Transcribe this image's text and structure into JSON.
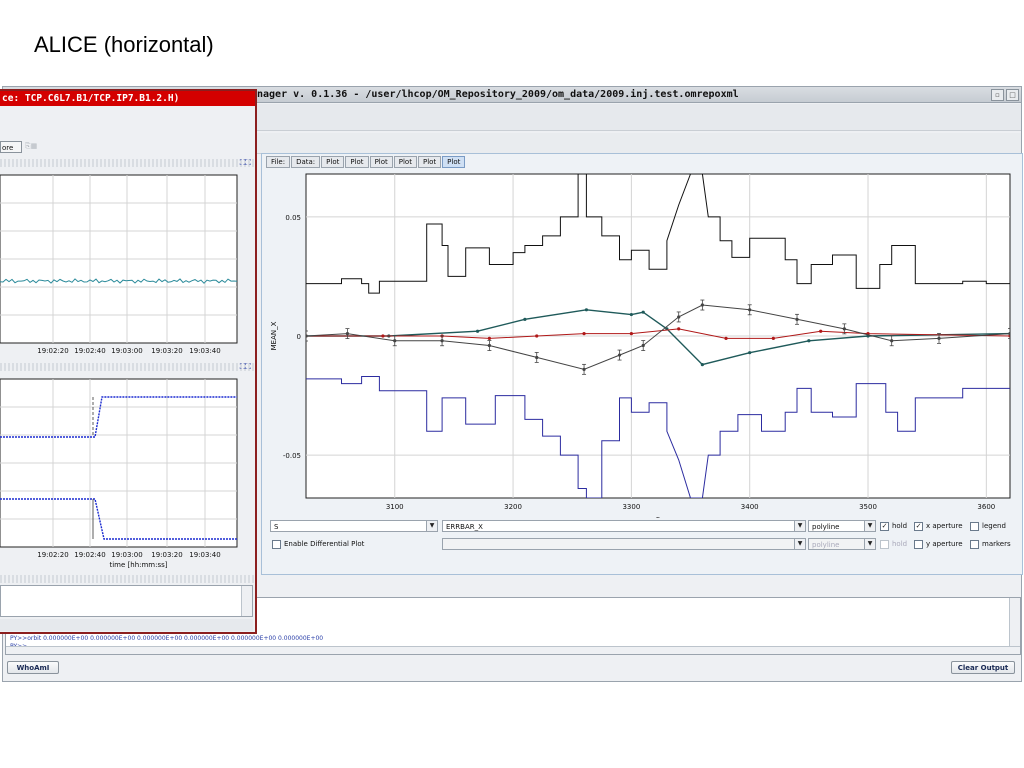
{
  "slide_title": "ALICE (horizontal)",
  "main_window": {
    "title": "nager v. 0.1.36 - /user/lhcop/OM_Repository_2009/om_data/2009.inj.test.omrepoxml"
  },
  "tabs": [
    {
      "label": "File:"
    },
    {
      "label": "Data:"
    },
    {
      "label": "Plot"
    },
    {
      "label": "Plot"
    },
    {
      "label": "Plot"
    },
    {
      "label": "Plot"
    },
    {
      "label": "Plot"
    },
    {
      "label": "Plot"
    }
  ],
  "active_tab_index": 7,
  "controls": {
    "x_variable": "S",
    "y_variable": "ERRBAR_X",
    "plot_style": "polyline",
    "plot_style_disabled": "polyline",
    "hold": {
      "label": "hold",
      "checked": true
    },
    "x_aperture": {
      "label": "x aperture",
      "checked": true
    },
    "legend": {
      "label": "legend",
      "checked": false
    },
    "hold2": {
      "label": "hold",
      "checked": false
    },
    "y_aperture": {
      "label": "y aperture",
      "checked": false
    },
    "markers": {
      "label": "markers",
      "checked": false
    },
    "enable_diff": {
      "label": "Enable Differential Plot",
      "checked": false
    }
  },
  "console": {
    "line1": "PY>>orbit    0.000000E+00  0.000000E+00  0.000000E+00  0.000000E+00  0.000000E+00  0.000000E+00",
    "line2": "PY>>"
  },
  "buttons": {
    "whoami": "WhoAmI",
    "clear_output": "Clear Output"
  },
  "overlay_window": {
    "title": "ce: TCP.C6L7.B1/TCP.IP7.B1.2.H)",
    "more_button": "ore",
    "chart1": {
      "x_ticks": [
        "19:02:20",
        "19:02:40",
        "19:03:00",
        "19:03:20",
        "19:03:40"
      ]
    },
    "chart2": {
      "x_ticks": [
        "19:02:20",
        "19:02:40",
        "19:03:00",
        "19:03:20",
        "19:03:40"
      ],
      "xlabel": "time [hh:mm:ss]"
    }
  },
  "chart_data": {
    "type": "line",
    "xlabel": "S",
    "ylabel": "MEAN_X",
    "xlim": [
      3025,
      3620
    ],
    "ylim": [
      -0.068,
      0.068
    ],
    "x_ticks": [
      3100,
      3200,
      3300,
      3400,
      3500,
      3600
    ],
    "y_ticks": [
      {
        "v": 0.05,
        "label": "0.05"
      },
      {
        "v": 0,
        "label": "0"
      },
      {
        "v": -0.05,
        "label": "-0.05"
      }
    ],
    "grid": true,
    "colors": {
      "aperture_top": "#111111",
      "aperture_bottom": "#2c2ca0",
      "orbit_teal": "#1f5a5a",
      "orbit_red": "#b01818",
      "orbit_grey": "#444444"
    },
    "aperture_top": [
      [
        3025,
        0.022
      ],
      [
        3055,
        0.022
      ],
      [
        3055,
        0.024
      ],
      [
        3072,
        0.024
      ],
      [
        3072,
        0.022
      ],
      [
        3078,
        0.022
      ],
      [
        3078,
        0.018
      ],
      [
        3087,
        0.018
      ],
      [
        3087,
        0.023
      ],
      [
        3127,
        0.023
      ],
      [
        3127,
        0.047
      ],
      [
        3140,
        0.047
      ],
      [
        3140,
        0.038
      ],
      [
        3145,
        0.038
      ],
      [
        3145,
        0.025
      ],
      [
        3160,
        0.025
      ],
      [
        3160,
        0.037
      ],
      [
        3180,
        0.037
      ],
      [
        3180,
        0.03
      ],
      [
        3200,
        0.03
      ],
      [
        3200,
        0.035
      ],
      [
        3210,
        0.035
      ],
      [
        3210,
        0.038
      ],
      [
        3225,
        0.038
      ],
      [
        3225,
        0.042
      ],
      [
        3240,
        0.042
      ],
      [
        3240,
        0.05
      ],
      [
        3255,
        0.05
      ],
      [
        3255,
        0.068
      ],
      [
        3262,
        0.068
      ],
      [
        3262,
        0.05
      ],
      [
        3275,
        0.05
      ],
      [
        3275,
        0.042
      ],
      [
        3290,
        0.042
      ],
      [
        3290,
        0.032
      ],
      [
        3300,
        0.032
      ],
      [
        3300,
        0.036
      ],
      [
        3315,
        0.036
      ],
      [
        3315,
        0.028
      ],
      [
        3330,
        0.028
      ],
      [
        3330,
        0.04
      ],
      [
        3340,
        0.055
      ],
      [
        3350,
        0.068
      ],
      [
        3360,
        0.068
      ],
      [
        3365,
        0.05
      ],
      [
        3375,
        0.05
      ],
      [
        3375,
        0.04
      ],
      [
        3385,
        0.04
      ],
      [
        3385,
        0.033
      ],
      [
        3400,
        0.033
      ],
      [
        3400,
        0.041
      ],
      [
        3430,
        0.041
      ],
      [
        3430,
        0.032
      ],
      [
        3440,
        0.032
      ],
      [
        3440,
        0.022
      ],
      [
        3452,
        0.022
      ],
      [
        3452,
        0.03
      ],
      [
        3470,
        0.03
      ],
      [
        3470,
        0.034
      ],
      [
        3490,
        0.034
      ],
      [
        3490,
        0.02
      ],
      [
        3510,
        0.02
      ],
      [
        3510,
        0.03
      ],
      [
        3520,
        0.03
      ],
      [
        3520,
        0.038
      ],
      [
        3540,
        0.038
      ],
      [
        3540,
        0.022
      ],
      [
        3580,
        0.022
      ],
      [
        3580,
        0.023
      ],
      [
        3600,
        0.023
      ],
      [
        3600,
        0.022
      ],
      [
        3620,
        0.022
      ]
    ],
    "aperture_bottom": [
      [
        3025,
        -0.018
      ],
      [
        3055,
        -0.018
      ],
      [
        3055,
        -0.02
      ],
      [
        3072,
        -0.02
      ],
      [
        3072,
        -0.017
      ],
      [
        3087,
        -0.017
      ],
      [
        3087,
        -0.023
      ],
      [
        3127,
        -0.023
      ],
      [
        3127,
        -0.04
      ],
      [
        3140,
        -0.04
      ],
      [
        3140,
        -0.026
      ],
      [
        3160,
        -0.026
      ],
      [
        3160,
        -0.037
      ],
      [
        3185,
        -0.037
      ],
      [
        3185,
        -0.025
      ],
      [
        3210,
        -0.025
      ],
      [
        3210,
        -0.035
      ],
      [
        3225,
        -0.035
      ],
      [
        3225,
        -0.042
      ],
      [
        3240,
        -0.042
      ],
      [
        3240,
        -0.05
      ],
      [
        3255,
        -0.05
      ],
      [
        3255,
        -0.064
      ],
      [
        3262,
        -0.064
      ],
      [
        3262,
        -0.068
      ],
      [
        3275,
        -0.068
      ],
      [
        3275,
        -0.044
      ],
      [
        3290,
        -0.044
      ],
      [
        3290,
        -0.026
      ],
      [
        3300,
        -0.026
      ],
      [
        3300,
        -0.032
      ],
      [
        3315,
        -0.032
      ],
      [
        3315,
        -0.028
      ],
      [
        3330,
        -0.028
      ],
      [
        3330,
        -0.04
      ],
      [
        3340,
        -0.052
      ],
      [
        3350,
        -0.068
      ],
      [
        3360,
        -0.068
      ],
      [
        3365,
        -0.05
      ],
      [
        3375,
        -0.05
      ],
      [
        3375,
        -0.04
      ],
      [
        3390,
        -0.04
      ],
      [
        3390,
        -0.033
      ],
      [
        3410,
        -0.033
      ],
      [
        3410,
        -0.04
      ],
      [
        3430,
        -0.04
      ],
      [
        3430,
        -0.032
      ],
      [
        3440,
        -0.032
      ],
      [
        3440,
        -0.022
      ],
      [
        3452,
        -0.022
      ],
      [
        3452,
        -0.032
      ],
      [
        3470,
        -0.032
      ],
      [
        3470,
        -0.034
      ],
      [
        3490,
        -0.034
      ],
      [
        3490,
        -0.02
      ],
      [
        3515,
        -0.02
      ],
      [
        3515,
        -0.032
      ],
      [
        3525,
        -0.032
      ],
      [
        3525,
        -0.04
      ],
      [
        3540,
        -0.04
      ],
      [
        3540,
        -0.026
      ],
      [
        3580,
        -0.026
      ],
      [
        3580,
        -0.022
      ],
      [
        3620,
        -0.022
      ]
    ],
    "series": [
      {
        "key": "teal",
        "points": [
          [
            3025,
            0
          ],
          [
            3095,
            0
          ],
          [
            3170,
            0.002
          ],
          [
            3210,
            0.007
          ],
          [
            3262,
            0.011
          ],
          [
            3300,
            0.009
          ],
          [
            3310,
            0.01
          ],
          [
            3330,
            0.003
          ],
          [
            3360,
            -0.012
          ],
          [
            3400,
            -0.007
          ],
          [
            3450,
            -0.002
          ],
          [
            3500,
            0
          ],
          [
            3620,
            0.001
          ]
        ]
      },
      {
        "key": "red",
        "points": [
          [
            3025,
            0
          ],
          [
            3090,
            0
          ],
          [
            3140,
            0
          ],
          [
            3180,
            -0.001
          ],
          [
            3220,
            0
          ],
          [
            3260,
            0.001
          ],
          [
            3300,
            0.001
          ],
          [
            3340,
            0.003
          ],
          [
            3380,
            -0.001
          ],
          [
            3420,
            -0.001
          ],
          [
            3460,
            0.002
          ],
          [
            3500,
            0.001
          ],
          [
            3620,
            0
          ]
        ]
      },
      {
        "key": "grey",
        "points": [
          [
            3025,
            0
          ],
          [
            3060,
            0.001
          ],
          [
            3100,
            -0.002
          ],
          [
            3140,
            -0.002
          ],
          [
            3180,
            -0.004
          ],
          [
            3220,
            -0.009
          ],
          [
            3260,
            -0.014
          ],
          [
            3290,
            -0.008
          ],
          [
            3310,
            -0.004
          ],
          [
            3340,
            0.008
          ],
          [
            3360,
            0.013
          ],
          [
            3400,
            0.011
          ],
          [
            3440,
            0.007
          ],
          [
            3480,
            0.003
          ],
          [
            3520,
            -0.002
          ],
          [
            3560,
            -0.001
          ],
          [
            3620,
            0.001
          ]
        ]
      }
    ]
  }
}
